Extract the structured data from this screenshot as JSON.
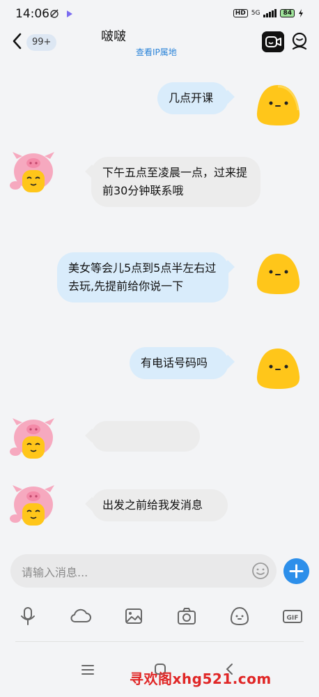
{
  "status_bar": {
    "time": "14:06",
    "indicators": "HD",
    "network": "5G",
    "battery": "84"
  },
  "header": {
    "unread_count": "99+",
    "contact_name": "啵啵",
    "ip_link": "查看IP属地"
  },
  "messages": [
    {
      "side": "mine",
      "text": "几点开课"
    },
    {
      "side": "theirs",
      "text": "下午五点至凌晨一点，过来提前30分钟联系哦"
    },
    {
      "side": "mine",
      "text": "美女等会儿5点到5点半左右过去玩,先提前给你说一下"
    },
    {
      "side": "mine",
      "text": "有电话号码吗"
    },
    {
      "side": "theirs",
      "text": ""
    },
    {
      "side": "theirs",
      "text": "出发之前给我发消息"
    }
  ],
  "input": {
    "placeholder": "请输入消息..."
  },
  "toolbar": [
    "microphone-icon",
    "cloud-icon",
    "image-icon",
    "camera-icon",
    "emoji-icon",
    "gif-icon"
  ],
  "watermark": "寻欢阁xhg521.com",
  "colors": {
    "my_bubble": "#d9ecfb",
    "their_bubble": "#ececec",
    "accent": "#2d8fea",
    "link": "#2a83d8",
    "watermark": "#e02626"
  }
}
